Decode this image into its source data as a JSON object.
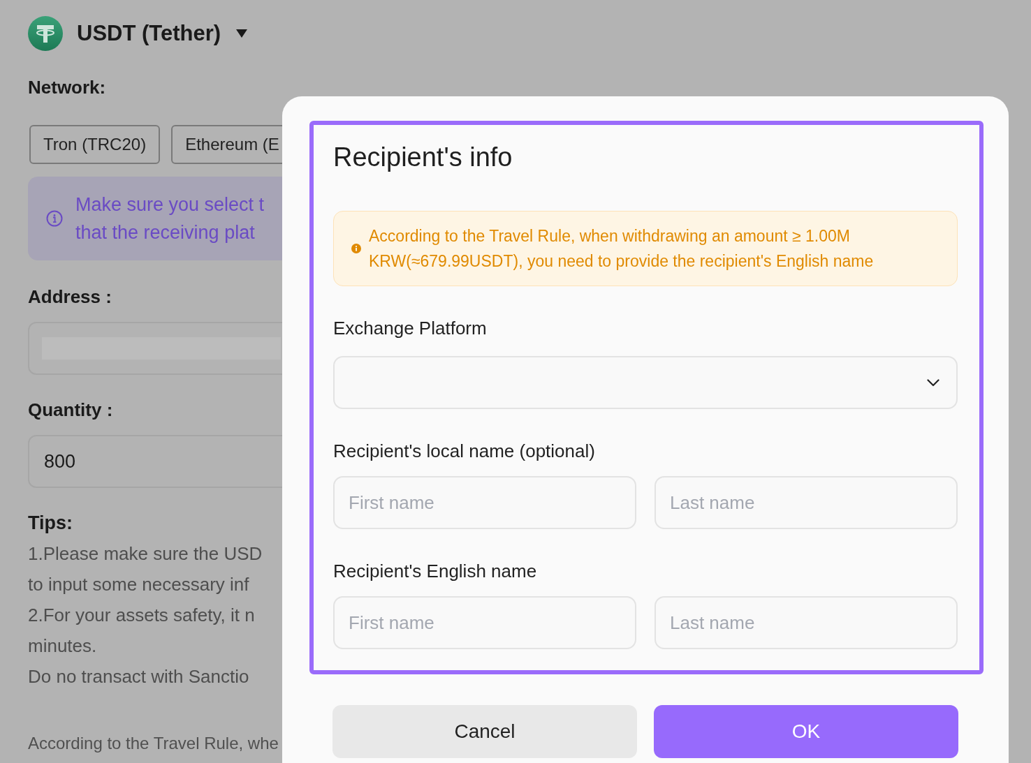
{
  "asset": {
    "name": "USDT (Tether)"
  },
  "network": {
    "label": "Network:",
    "options": [
      {
        "label": "Tron (TRC20)",
        "selected": false
      },
      {
        "label": "Ethereum (E",
        "selected": false
      }
    ]
  },
  "notice": {
    "lines": [
      "Make sure you select t",
      "that the receiving plat"
    ]
  },
  "address": {
    "label": "Address :",
    "redacted": true
  },
  "quantity": {
    "label": "Quantity :",
    "value": "800"
  },
  "tips": {
    "title": "Tips:",
    "lines": [
      "1.Please make sure the USD",
      "to input some necessary inf",
      "2.For your assets safety, it n",
      "minutes.",
      "Do no transact with Sanctio"
    ]
  },
  "footnote": "According to the Travel Rule, whe",
  "dialog": {
    "title": "Recipient's info",
    "warning": "According to the Travel Rule, when withdrawing an amount ≥ 1.00M KRW(≈679.99USDT), you need to provide the recipient's English name",
    "fields": [
      {
        "kind": "select",
        "label": "Exchange Platform"
      },
      {
        "kind": "name_pair",
        "label": "Recipient's local name (optional)",
        "inputs": [
          {
            "placeholder": "First name"
          },
          {
            "placeholder": "Last name"
          }
        ]
      },
      {
        "kind": "name_pair",
        "label": "Recipient's English name",
        "inputs": [
          {
            "placeholder": "First name"
          },
          {
            "placeholder": "Last name"
          }
        ]
      }
    ],
    "buttons": [
      {
        "kind": "secondary",
        "label": "Cancel"
      },
      {
        "kind": "primary",
        "label": "OK"
      }
    ]
  }
}
